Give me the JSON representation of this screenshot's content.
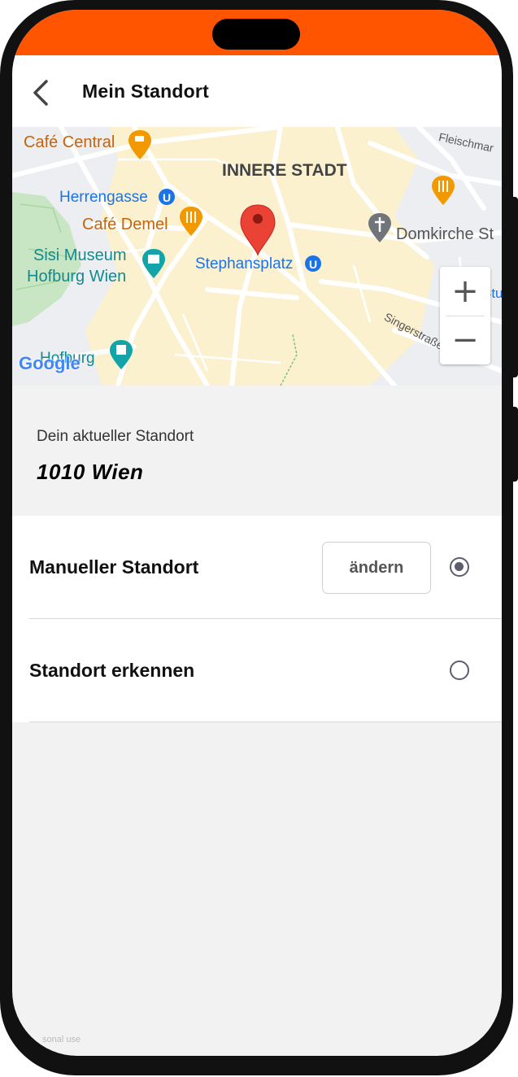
{
  "header": {
    "title": "Mein Standort"
  },
  "map": {
    "labels": {
      "cafe_central": "Café Central",
      "innere_stadt": "INNERE STADT",
      "fleischmarkt": "Fleischmar",
      "herrengasse": "Herrengasse",
      "cafe_demel": "Café Demel",
      "sisi_museum_1": "Sisi Museum",
      "sisi_museum_2": "Hofburg Wien",
      "stephansplatz": "Stephansplatz",
      "domkirche": "Domkirche St",
      "singerstrasse": "Singerstraße",
      "hofburg": "Hofburg",
      "stu": "Stu",
      "google": "Google"
    },
    "zoom_in_label": "+",
    "zoom_out_label": "−",
    "colors": {
      "orange_poi": "#f29900",
      "blue_transit": "#1a73e8",
      "teal_poi": "#12a4a8",
      "marker": "#ea4335"
    }
  },
  "location": {
    "label": "Dein aktueller Standort",
    "value": "1010 Wien"
  },
  "options": [
    {
      "label": "Manueller Standort",
      "button_label": "ändern",
      "selected": true
    },
    {
      "label": "Standort erkennen",
      "selected": false
    }
  ],
  "footer": {
    "watermark": "sonal use"
  },
  "theme": {
    "accent": "#ff5500"
  }
}
